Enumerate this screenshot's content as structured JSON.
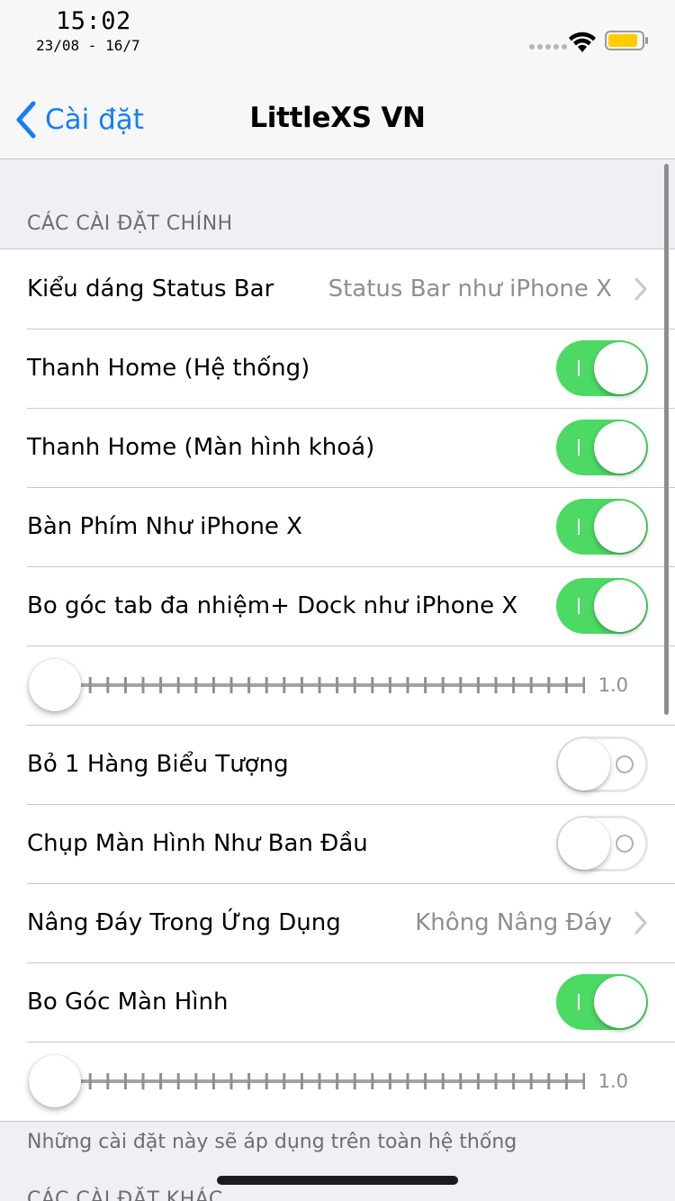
{
  "status_bar": {
    "time": "15:02",
    "date": "23/08 - 16/7",
    "icons": [
      "signal-dots-icon",
      "wifi-icon",
      "battery-icon"
    ],
    "battery_color": "#ffcc00"
  },
  "nav": {
    "back_label": "Cài đặt",
    "title": "LittleXS VN",
    "accent_color": "#157efb"
  },
  "section": {
    "header": "CÁC CÀI ĐẶT CHÍNH",
    "footer": "Những cài đặt này sẽ áp dụng trên toàn hệ thống",
    "rows": [
      {
        "type": "disclosure",
        "label": "Kiểu dáng Status Bar",
        "value": "Status Bar như iPhone X"
      },
      {
        "type": "switch",
        "label": "Thanh Home (Hệ thống)",
        "on": true
      },
      {
        "type": "switch",
        "label": "Thanh Home (Màn hình khoá)",
        "on": true
      },
      {
        "type": "switch",
        "label": "Bàn Phím Như iPhone X",
        "on": true
      },
      {
        "type": "switch",
        "label": "Bo góc tab đa nhiệm+ Dock như iPhone X",
        "on": true
      },
      {
        "type": "slider",
        "value_text": "1.0",
        "position": 0
      },
      {
        "type": "switch",
        "label": "Bỏ 1 Hàng Biểu Tượng",
        "on": false
      },
      {
        "type": "switch",
        "label": "Chụp Màn Hình Như Ban Đầu",
        "on": false
      },
      {
        "type": "disclosure",
        "label": "Nâng Đáy Trong Ứng Dụng",
        "value": "Không Nâng Đáy"
      },
      {
        "type": "switch",
        "label": "Bo Góc Màn Hình",
        "on": true
      },
      {
        "type": "slider",
        "value_text": "1.0",
        "position": 0
      }
    ]
  },
  "next_section": {
    "header": "CÁC CÀI ĐẶT KHÁC"
  },
  "colors": {
    "switch_on": "#4cd964",
    "background": "#efeff4",
    "separator": "#c8c7cc"
  }
}
